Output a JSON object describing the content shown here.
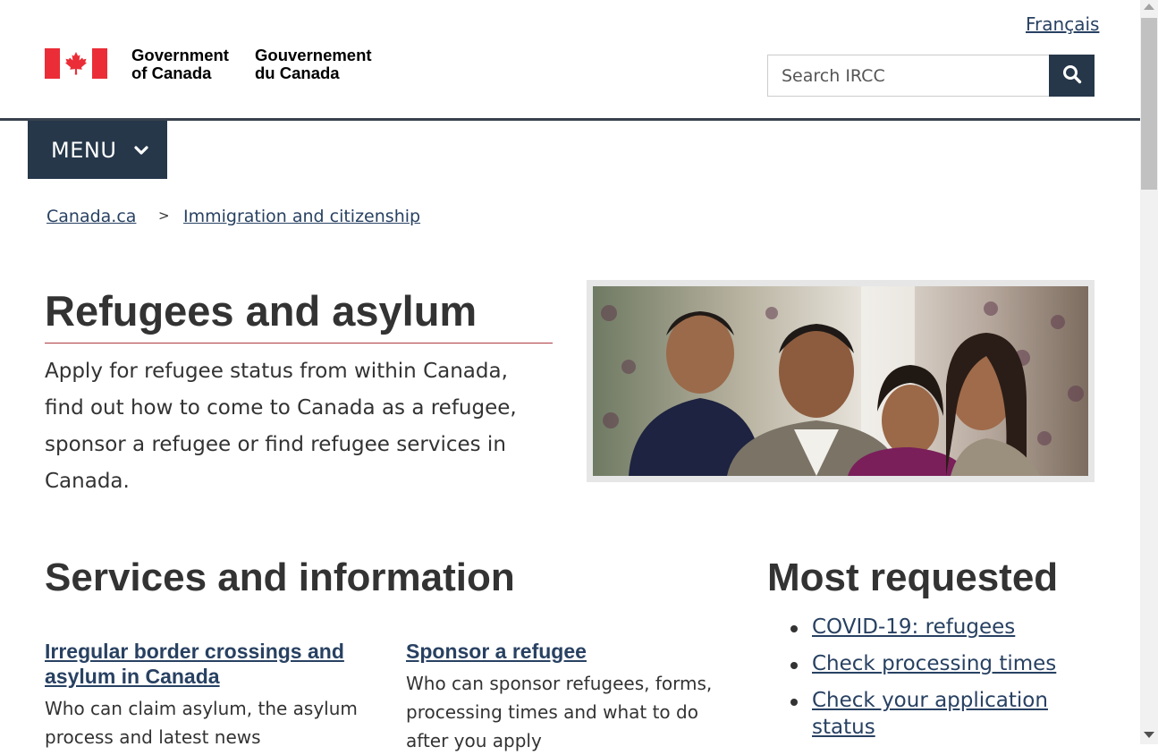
{
  "header": {
    "language_link": "Français",
    "signature_en": [
      "Government",
      "of Canada"
    ],
    "signature_fr": [
      "Gouvernement",
      "du Canada"
    ],
    "search_placeholder": "Search IRCC",
    "menu_label": "MENU"
  },
  "breadcrumb": {
    "items": [
      "Canada.ca",
      "Immigration and citizenship"
    ],
    "separator": ">"
  },
  "main": {
    "title": "Refugees and asylum",
    "intro": "Apply for refugee status from within Canada, find out how to come to Canada as a refugee, sponsor a refugee or find refugee services in Canada."
  },
  "services": {
    "title": "Services and information",
    "items": [
      {
        "link": "Irregular border crossings and asylum in Canada",
        "description": "Who can claim asylum, the asylum process and latest news"
      },
      {
        "link": "Sponsor a refugee",
        "description": "Who can sponsor refugees, forms, processing times and what to do after you apply"
      }
    ]
  },
  "most_requested": {
    "title": "Most requested",
    "items": [
      "COVID-19: refugees",
      "Check processing times",
      "Check your application status"
    ]
  },
  "colors": {
    "brand_dark": "#26374a",
    "link": "#284162",
    "title_rule": "#af3c43",
    "flag_red": "#eb2d37"
  }
}
